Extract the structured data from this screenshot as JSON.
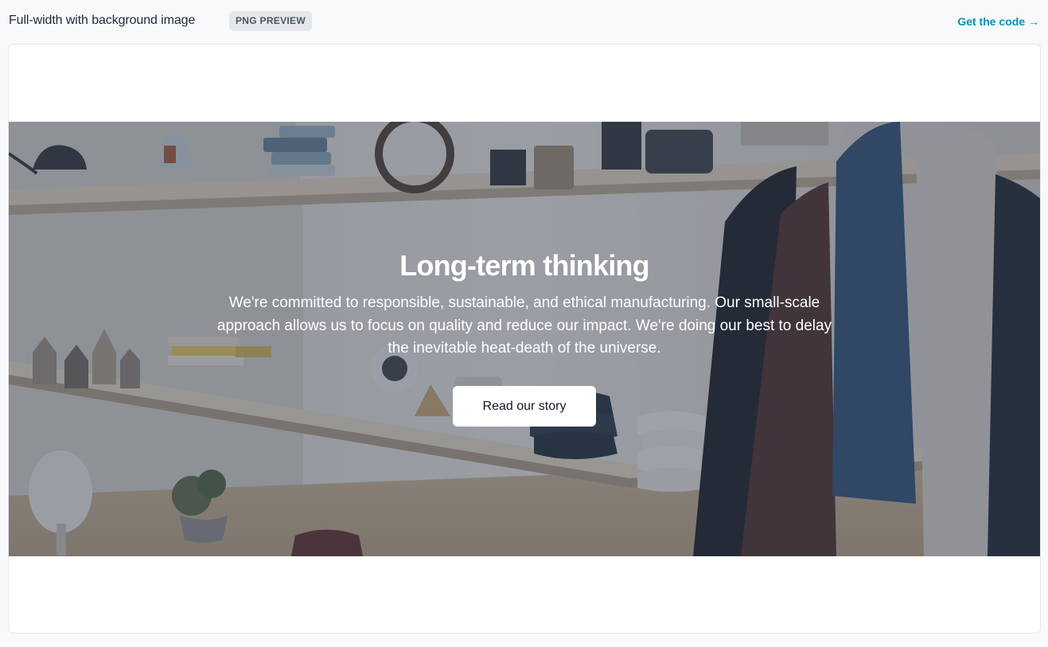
{
  "header": {
    "title": "Full-width with background image",
    "badge": "PNG PREVIEW",
    "code_link": "Get the code →"
  },
  "hero": {
    "heading": "Long-term thinking",
    "body": "We're committed to responsible, sustainable, and ethical manufacturing. Our small-scale approach allows us to focus on quality and reduce our impact. We're doing our best to delay the inevitable heat-death of the universe.",
    "button_label": "Read our story",
    "background_image": "shop-interior-shelves-photo"
  },
  "colors": {
    "accent": "#0891b2",
    "page_bg": "#f8f9fb",
    "overlay": "#374151"
  }
}
